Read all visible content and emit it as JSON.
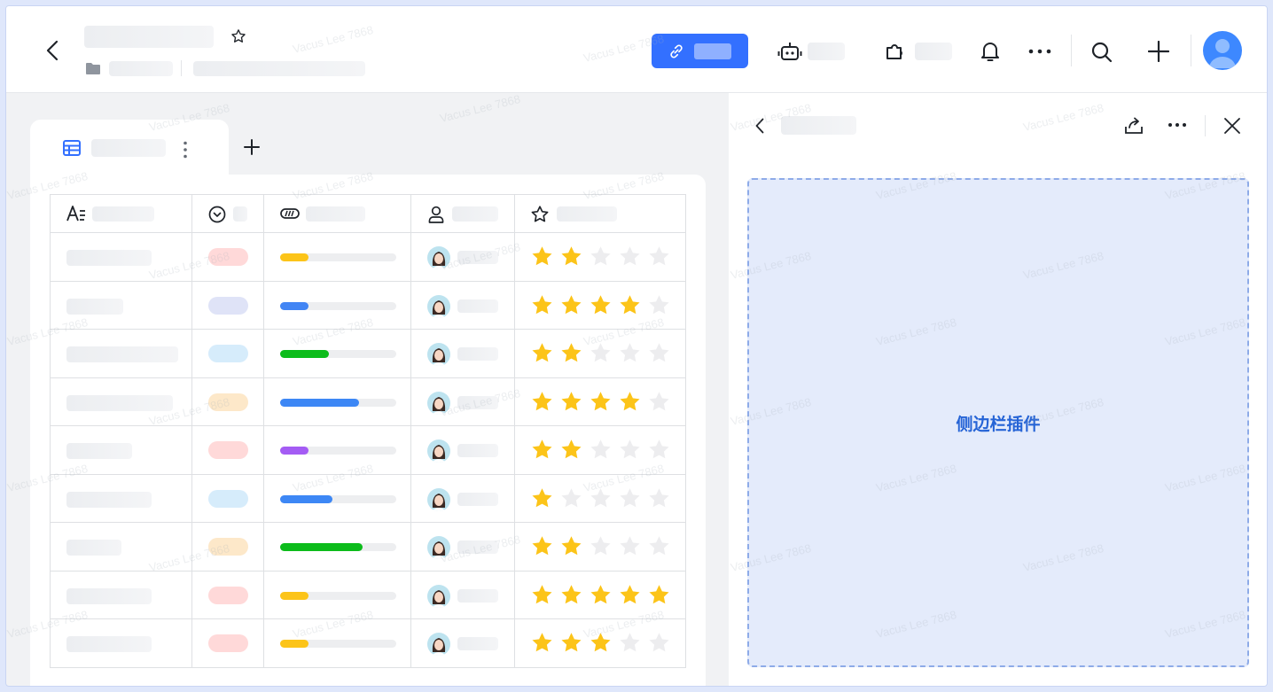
{
  "sidebar_plugin": {
    "label": "侧边栏插件"
  },
  "table": {
    "rows": [
      {
        "status_color": "#ffd9d9",
        "progress": 0.25,
        "progress_color": "#fcc419",
        "rating": 2
      },
      {
        "status_color": "#dfe3f7",
        "progress": 0.25,
        "progress_color": "#4285f4",
        "rating": 4
      },
      {
        "status_color": "#d6ecfb",
        "progress": 0.42,
        "progress_color": "#0cbc1b",
        "rating": 2
      },
      {
        "status_color": "#fde8c9",
        "progress": 0.68,
        "progress_color": "#3d87f5",
        "rating": 4
      },
      {
        "status_color": "#ffd9d9",
        "progress": 0.25,
        "progress_color": "#a45cf4",
        "rating": 2
      },
      {
        "status_color": "#d6ecfb",
        "progress": 0.45,
        "progress_color": "#3d87f5",
        "rating": 1
      },
      {
        "status_color": "#fde8c9",
        "progress": 0.71,
        "progress_color": "#0cbc1b",
        "rating": 2
      },
      {
        "status_color": "#ffd9d9",
        "progress": 0.25,
        "progress_color": "#fcc419",
        "rating": 5
      },
      {
        "status_color": "#ffd9d9",
        "progress": 0.25,
        "progress_color": "#fcc419",
        "rating": 3
      }
    ],
    "max_rating": 5
  },
  "watermark": "Vacus Lee 7868",
  "colors": {
    "accent": "#3370ff",
    "star_on": "#fcc419",
    "star_off": "#ededef",
    "plugin_text": "#2664d6"
  },
  "icons": [
    "back-icon",
    "star-outline-icon",
    "folder-icon",
    "link-icon",
    "robot-icon",
    "puzzle-icon",
    "bell-icon",
    "more-icon",
    "search-icon",
    "plus-icon",
    "avatar",
    "grid-view-icon",
    "text-field-icon",
    "single-select-icon",
    "progress-field-icon",
    "person-field-icon",
    "rating-field-icon",
    "share-icon",
    "close-icon"
  ]
}
